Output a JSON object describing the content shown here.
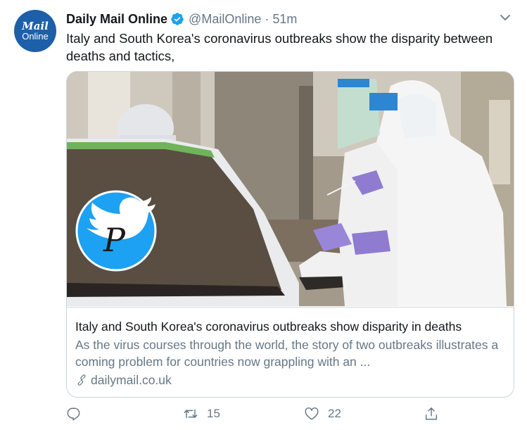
{
  "author": {
    "avatar_line1": "Mail",
    "avatar_line2": "Online",
    "name": "Daily Mail Online",
    "handle": "@MailOnline",
    "separator": "·",
    "time": "51m"
  },
  "tweet": {
    "text": "Italy and South Korea's coronavirus outbreaks show the disparity between deaths and tactics,"
  },
  "card": {
    "title": "Italy and South Korea's coronavirus outbreaks show disparity in deaths",
    "description": "As the virus courses through the world, the story of two outbreaks illustrates a coming problem for countries now grappling with an ...",
    "link": "dailymail.co.uk",
    "overlay_letter": "P"
  },
  "actions": {
    "reply_count": "",
    "retweet_count": "15",
    "like_count": "22"
  },
  "icons": {
    "verified": "verified-badge-icon",
    "more": "chevron-down-icon",
    "link": "link-icon",
    "reply": "reply-icon",
    "retweet": "retweet-icon",
    "like": "heart-icon",
    "share": "share-icon"
  },
  "colors": {
    "accent": "#1da1f2",
    "avatar_bg": "#1d5fa8",
    "text_primary": "#14171a",
    "text_secondary": "#657786",
    "border": "#ccd6dd"
  }
}
